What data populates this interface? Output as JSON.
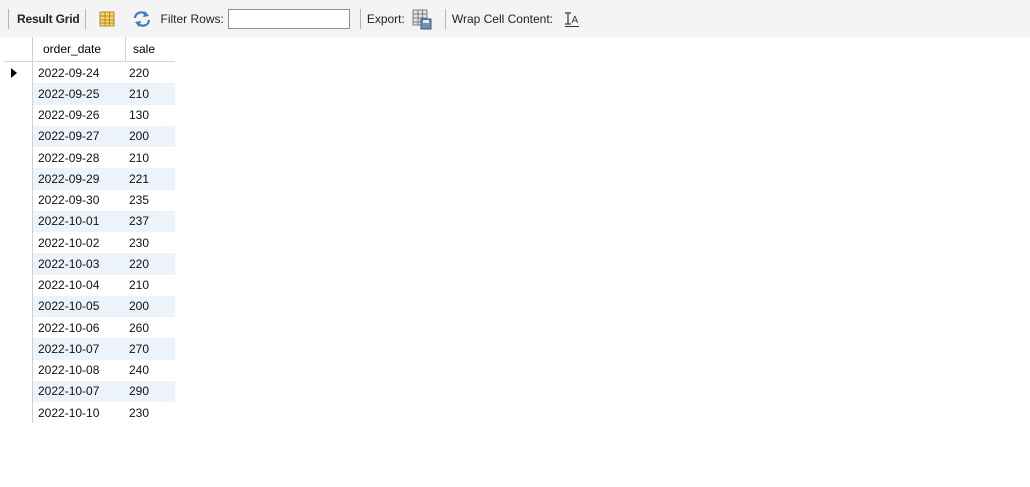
{
  "toolbar": {
    "result_grid_label": "Result Grid",
    "filter_rows_label": "Filter Rows:",
    "filter_rows_value": "",
    "export_label": "Export:",
    "wrap_cell_label": "Wrap Cell Content:"
  },
  "grid": {
    "columns": [
      "order_date",
      "sale"
    ],
    "rows": [
      [
        "2022-09-24",
        "220"
      ],
      [
        "2022-09-25",
        "210"
      ],
      [
        "2022-09-26",
        "130"
      ],
      [
        "2022-09-27",
        "200"
      ],
      [
        "2022-09-28",
        "210"
      ],
      [
        "2022-09-29",
        "221"
      ],
      [
        "2022-09-30",
        "235"
      ],
      [
        "2022-10-01",
        "237"
      ],
      [
        "2022-10-02",
        "230"
      ],
      [
        "2022-10-03",
        "220"
      ],
      [
        "2022-10-04",
        "210"
      ],
      [
        "2022-10-05",
        "200"
      ],
      [
        "2022-10-06",
        "260"
      ],
      [
        "2022-10-07",
        "270"
      ],
      [
        "2022-10-08",
        "240"
      ],
      [
        "2022-10-07",
        "290"
      ],
      [
        "2022-10-10",
        "230"
      ]
    ]
  },
  "colors": {
    "toolbar_bg": "#f4f4f4",
    "alt_row_bg": "#edf3fb",
    "refresh_icon": "#3c78c8"
  }
}
